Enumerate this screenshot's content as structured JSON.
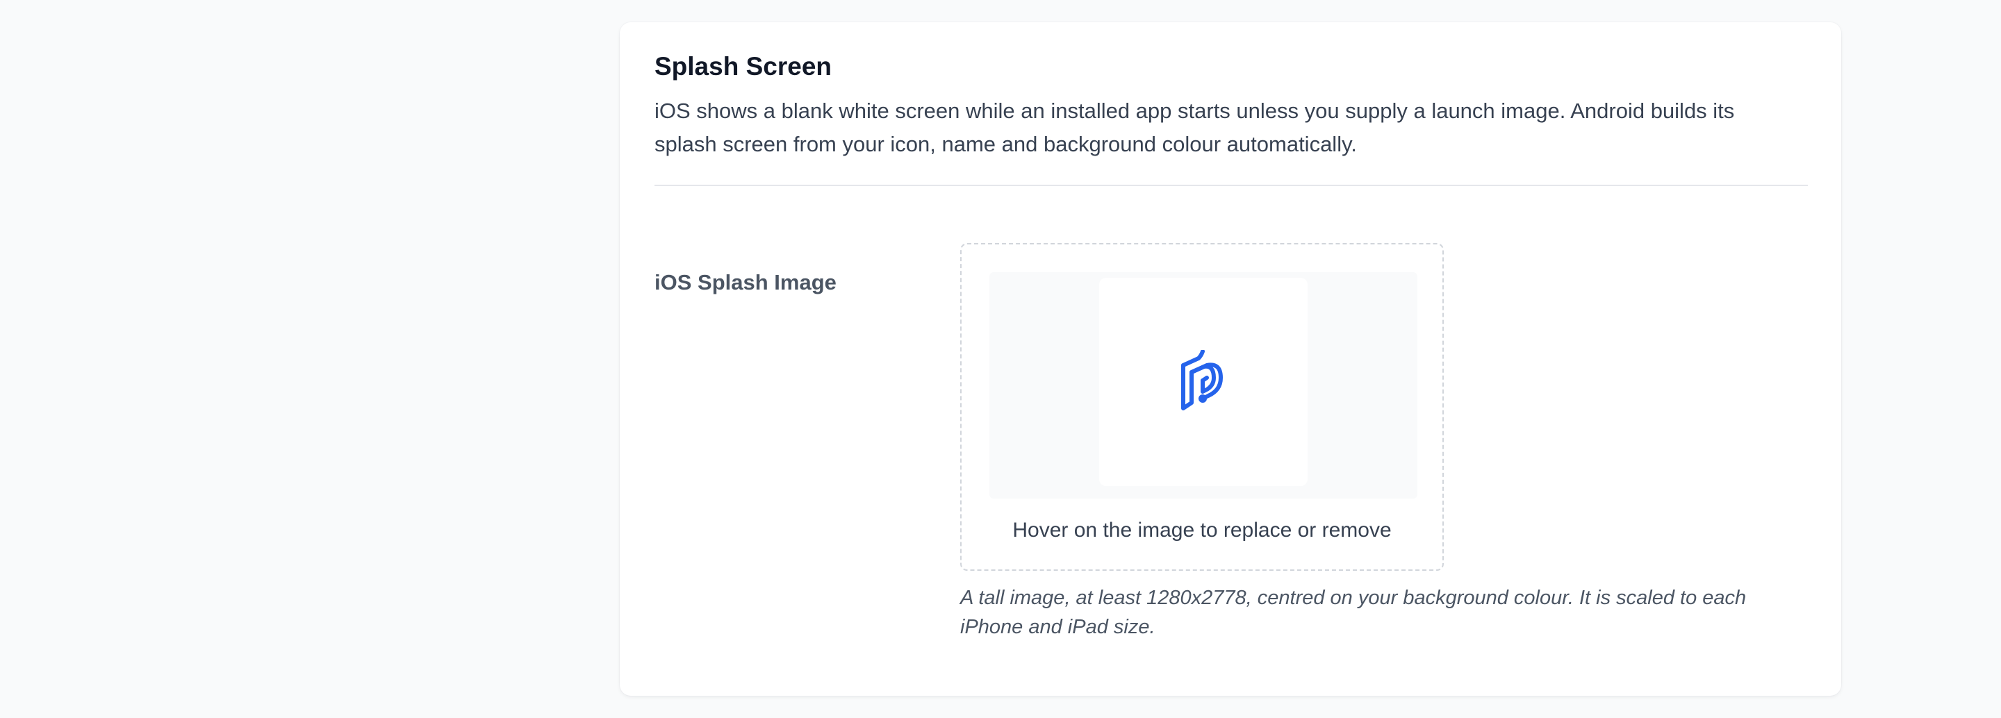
{
  "section": {
    "title": "Splash Screen",
    "description": "iOS shows a blank white screen while an installed app starts unless you supply a launch image. Android builds its splash screen from your icon, name and background colour automatically."
  },
  "field": {
    "label": "iOS Splash Image",
    "hint": "Hover on the image to replace or remove",
    "help": "A tall image, at least 1280x2778, centred on your background colour. It is scaled to each iPhone and iPad size.",
    "image_icon": "brand-logo-icon"
  },
  "colors": {
    "accent": "#2563eb",
    "background": "#f9fafb",
    "card": "#ffffff"
  }
}
